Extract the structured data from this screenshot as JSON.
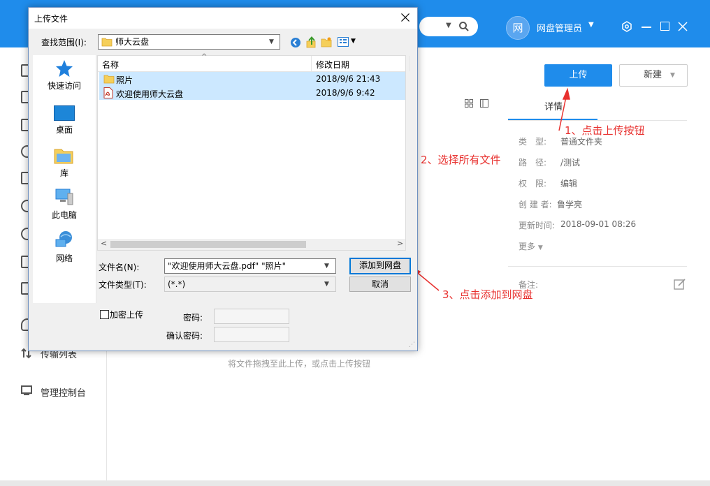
{
  "app": {
    "user_avatar_char": "网",
    "user_name": "网盘管理员",
    "upload_label": "上传",
    "new_label": "新建",
    "empty_hint": "将文件拖拽至此上传，或点击上传按钮",
    "sidebar_items": [
      {
        "label": "传输列表"
      },
      {
        "label": "管理控制台"
      }
    ],
    "detail_tab": "详情",
    "details": [
      {
        "label": "类　型:",
        "value": "普通文件夹"
      },
      {
        "label": "路　径:",
        "value": "/测试"
      },
      {
        "label": "权　限:",
        "value": "编辑"
      },
      {
        "label": "创 建 者:",
        "value": "鲁学亮"
      },
      {
        "label": "更新时间:",
        "value": "2018-09-01 08:26"
      }
    ],
    "more_label": "更多",
    "remark_label": "备注:"
  },
  "dialog": {
    "title": "上传文件",
    "look_in_label": "查找范围(I):",
    "look_in_value": "师大云盘",
    "places": [
      "快速访问",
      "桌面",
      "库",
      "此电脑",
      "网络"
    ],
    "columns": {
      "name": "名称",
      "modified": "修改日期"
    },
    "files": [
      {
        "name": "照片",
        "date": "2018/9/6 21:43",
        "icon": "folder-icon"
      },
      {
        "name": "欢迎使用师大云盘",
        "date": "2018/9/6 9:42",
        "icon": "pdf-icon"
      }
    ],
    "filename_label": "文件名(N):",
    "filename_value": "\"欢迎使用师大云盘.pdf\" \"照片\"",
    "filetype_label": "文件类型(T):",
    "filetype_value": "(*.*)",
    "add_button": "添加到网盘",
    "cancel_button": "取消",
    "encrypt_label": "加密上传",
    "password_label": "密码:",
    "confirm_password_label": "确认密码:"
  },
  "annotations": {
    "step1": "1、点击上传按钮",
    "step2": "2、选择所有文件",
    "step3": "3、点击添加到网盘"
  },
  "colors": {
    "brand": "#1f8ceb",
    "annotation": "#e8312f",
    "selection": "#cce8ff"
  }
}
